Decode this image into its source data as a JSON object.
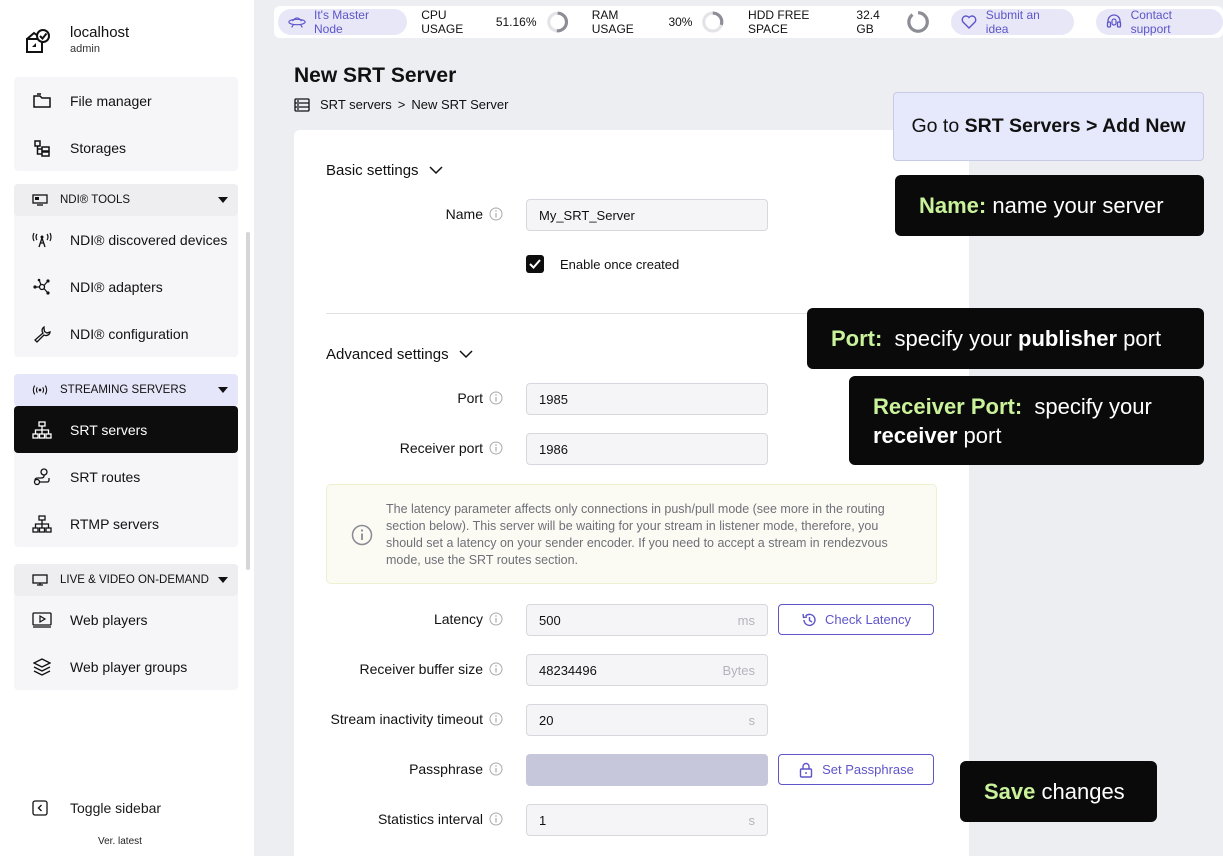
{
  "sidebar": {
    "host": "localhost",
    "user": "admin",
    "group1": [
      {
        "label": "File manager",
        "icon": "folder-icon"
      },
      {
        "label": "Storages",
        "icon": "storages-icon"
      }
    ],
    "ndi_header": "NDI® TOOLS",
    "ndi_items": [
      {
        "label": "NDI® discovered devices",
        "icon": "antenna-icon"
      },
      {
        "label": "NDI® adapters",
        "icon": "network-icon"
      },
      {
        "label": "NDI® configuration",
        "icon": "wrench-icon"
      }
    ],
    "streaming_header": "STREAMING SERVERS",
    "streaming_items": [
      {
        "label": "SRT servers",
        "icon": "hierarchy-icon",
        "active": true
      },
      {
        "label": "SRT routes",
        "icon": "route-icon"
      },
      {
        "label": "RTMP servers",
        "icon": "hierarchy-icon"
      }
    ],
    "vod_header": "LIVE & VIDEO ON-DEMAND",
    "vod_items": [
      {
        "label": "Web players",
        "icon": "player-icon"
      },
      {
        "label": "Web player groups",
        "icon": "layers-icon"
      }
    ],
    "toggle_label": "Toggle sidebar",
    "version": "Ver. latest"
  },
  "topbar": {
    "master_node": "It's Master Node",
    "cpu_label": "CPU USAGE",
    "cpu_value": "51.16%",
    "cpu_fraction": 0.5116,
    "ram_label": "RAM USAGE",
    "ram_value": "30%",
    "ram_fraction": 0.3,
    "hdd_label": "HDD FREE SPACE",
    "hdd_value": "32.4 GB",
    "submit_idea": "Submit an idea",
    "contact_support": "Contact support"
  },
  "page": {
    "title": "New SRT Server",
    "breadcrumb_parent": "SRT servers",
    "breadcrumb_sep": ">",
    "breadcrumb_current": "New SRT Server"
  },
  "form": {
    "basic_title": "Basic settings",
    "name_label": "Name",
    "name_value": "My_SRT_Server",
    "enable_label": "Enable once created",
    "enable_checked": true,
    "advanced_title": "Advanced settings",
    "port_label": "Port",
    "port_value": "1985",
    "receiver_port_label": "Receiver port",
    "receiver_port_value": "1986",
    "notice": "The latency parameter affects only connections in push/pull mode (see more in the routing section below). This server will be waiting for your stream in listener mode, therefore, you should set a latency on your sender encoder. If you need to accept a stream in rendezvous mode, use the SRT routes section.",
    "latency_label": "Latency",
    "latency_value": "500",
    "latency_unit": "ms",
    "check_latency": "Check Latency",
    "rcvbuf_label": "Receiver buffer size",
    "rcvbuf_value": "48234496",
    "rcvbuf_unit": "Bytes",
    "inactivity_label": "Stream inactivity timeout",
    "inactivity_value": "20",
    "inactivity_unit": "s",
    "passphrase_label": "Passphrase",
    "set_passphrase": "Set Passphrase",
    "stats_label": "Statistics interval",
    "stats_value": "1",
    "stats_unit": "s"
  },
  "annotations": {
    "goto_prefix": "Go to ",
    "goto_bold": "SRT Servers > Add New",
    "name_hl": "Name:",
    "name_text": " name your server",
    "port_hl": "Port:",
    "port_text1": "  specify your ",
    "port_bold": "publisher",
    "port_text2": " port",
    "rport_hl": "Receiver Port:",
    "rport_text1": "  specify your",
    "rport_bold": "receiver",
    "rport_text2": " port",
    "save_hl": "Save",
    "save_text": " changes"
  },
  "colors": {
    "accent": "#5e55c9",
    "highlight": "#c9f29b",
    "active_nav": "#0d0d0d"
  }
}
